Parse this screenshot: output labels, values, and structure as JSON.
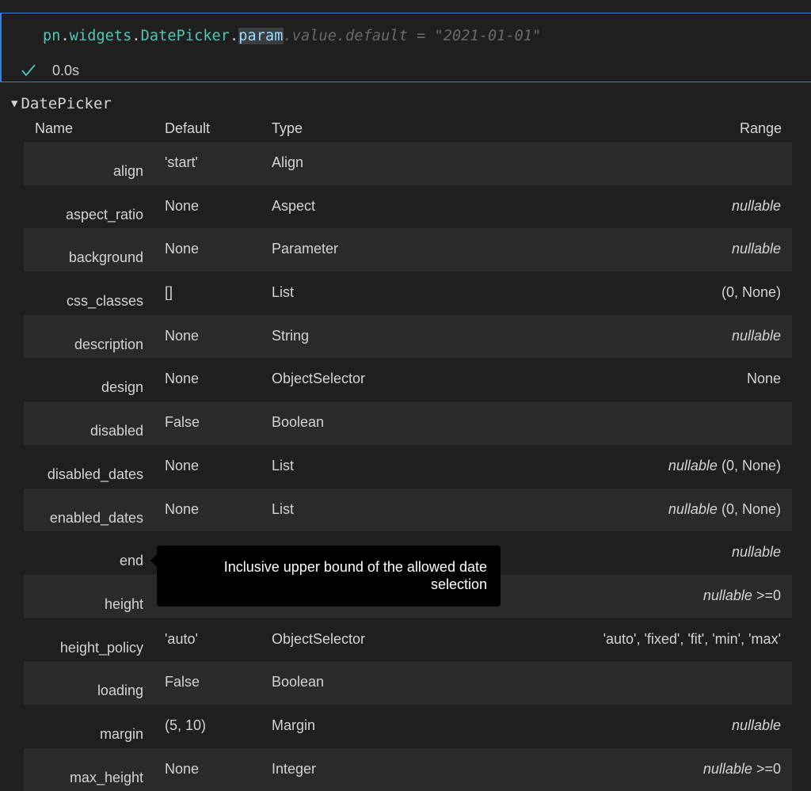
{
  "cell": {
    "code": {
      "t1": "pn",
      "t2": ".",
      "t3": "widgets",
      "t4": ".",
      "t5": "DatePicker",
      "t6": ".",
      "t7": "param",
      "ghost": ".value.default = \"2021-01-01\""
    },
    "exec_time": "0.0s",
    "status_icon": "checkmark-icon"
  },
  "output": {
    "title_icon": "triangle-down-icon",
    "title": "DatePicker",
    "headers": {
      "name": "Name",
      "default": "Default",
      "type": "Type",
      "range": "Range"
    },
    "rows": [
      {
        "name": "align",
        "default": "'start'",
        "type": "Align",
        "range_italic": "",
        "range": ""
      },
      {
        "name": "aspect_ratio",
        "default": "None",
        "type": "Aspect",
        "range_italic": "nullable",
        "range": ""
      },
      {
        "name": "background",
        "default": "None",
        "type": "Parameter",
        "range_italic": "nullable",
        "range": ""
      },
      {
        "name": "css_classes",
        "default": "[]",
        "type": "List",
        "range_italic": "",
        "range": "(0, None)"
      },
      {
        "name": "description",
        "default": "None",
        "type": "String",
        "range_italic": "nullable",
        "range": ""
      },
      {
        "name": "design",
        "default": "None",
        "type": "ObjectSelector",
        "range_italic": "",
        "range": "None"
      },
      {
        "name": "disabled",
        "default": "False",
        "type": "Boolean",
        "range_italic": "",
        "range": ""
      },
      {
        "name": "disabled_dates",
        "default": "None",
        "type": "List",
        "range_italic": "nullable",
        "range": " (0, None)"
      },
      {
        "name": "enabled_dates",
        "default": "None",
        "type": "List",
        "range_italic": "nullable",
        "range": " (0, None)"
      },
      {
        "name": "end",
        "default": "",
        "type": "",
        "range_italic": "nullable",
        "range": ""
      },
      {
        "name": "height",
        "default": "",
        "type": "",
        "range_italic": "nullable",
        "range": " >=0"
      },
      {
        "name": "height_policy",
        "default": "'auto'",
        "type": "ObjectSelector",
        "range_italic": "",
        "range": "'auto', 'fixed', 'fit', 'min', 'max'"
      },
      {
        "name": "loading",
        "default": "False",
        "type": "Boolean",
        "range_italic": "",
        "range": ""
      },
      {
        "name": "margin",
        "default": "(5, 10)",
        "type": "Margin",
        "range_italic": "nullable",
        "range": ""
      },
      {
        "name": "max_height",
        "default": "None",
        "type": "Integer",
        "range_italic": "nullable",
        "range": " >=0"
      }
    ],
    "tooltip": {
      "line1": "Inclusive upper bound of the allowed date",
      "line2": "selection"
    }
  },
  "colors": {
    "background": "#1f1f1f",
    "cell_border": "#3a7fd5",
    "row_shade": "#2a2a2a",
    "code_module": "#4ec9b0",
    "code_highlight": "#9cdcfe"
  }
}
